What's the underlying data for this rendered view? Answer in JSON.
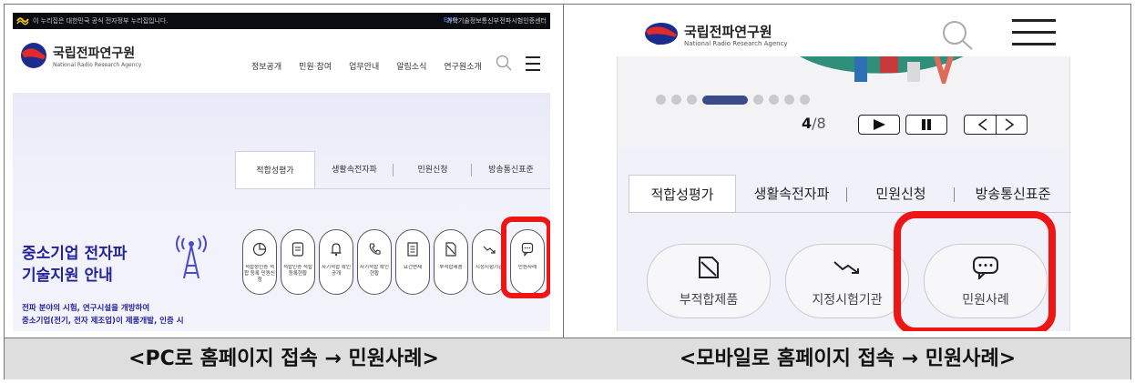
{
  "pc": {
    "gov_bar": {
      "text": "이 누리집은 대한민국 공식 전자정부 누리집입니다.",
      "lang": "ENG",
      "link_ministry": "과학기술정보통신부",
      "link_center": "전파시험인증센터"
    },
    "logo": {
      "name": "국립전파연구원",
      "sub": "National Radio Research Agency"
    },
    "nav": [
      "정보공개",
      "민원·참여",
      "업무안내",
      "알림소식",
      "연구원소개"
    ],
    "tabs": [
      "적합성평가",
      "생활속전자파",
      "민원신청",
      "방송통신표준"
    ],
    "active_tab": "적합성평가",
    "promo": {
      "title_line1": "중소기업 전자파",
      "title_line2": "기술지원 안내",
      "desc_line1": "전파 분야의 시험, 연구시설을 개방하여",
      "desc_line2": "중소기업(전기, 전자 제조업)이 제품개발, 인증 시"
    },
    "quick_icons": [
      {
        "icon": "pie-chart-icon",
        "label": "적합성인증 적합 등록 민원신청"
      },
      {
        "icon": "receipt-icon",
        "label": "적합인증 적합등록현황"
      },
      {
        "icon": "bell-icon",
        "label": "자기적합 확인 공개"
      },
      {
        "icon": "phone-icon",
        "label": "자기적합 확인 현황"
      },
      {
        "icon": "document-icon",
        "label": "요건면제"
      },
      {
        "icon": "broken-doc-icon",
        "label": "부적합제품"
      },
      {
        "icon": "trend-down-icon",
        "label": "지정시험기관"
      },
      {
        "icon": "chat-bubble-icon",
        "label": "민원사례"
      }
    ]
  },
  "mobile": {
    "logo": {
      "name": "국립전파연구원",
      "sub": "National Radio Research Agency"
    },
    "slider": {
      "current": "4",
      "separator": "/",
      "total": "8",
      "dot_count": 9,
      "active_dot": 4
    },
    "tabs": [
      "적합성평가",
      "생활속전자파",
      "민원신청",
      "방송통신표준"
    ],
    "active_tab": "적합성평가",
    "cards": [
      {
        "icon": "broken-doc-icon",
        "label": "부적합제품"
      },
      {
        "icon": "trend-down-icon",
        "label": "지정시험기관"
      },
      {
        "icon": "chat-bubble-icon",
        "label": "민원사례"
      }
    ]
  },
  "captions": {
    "left": "<PC로 홈페이지 접속 → 민원사례>",
    "right": "<모바일로 홈페이지 접속 → 민원사례>"
  },
  "colors": {
    "highlight": "#ee1515",
    "brand_navy": "#23239a",
    "slider_active": "#3a4b8c",
    "gov_bar": "#0b0b12"
  }
}
